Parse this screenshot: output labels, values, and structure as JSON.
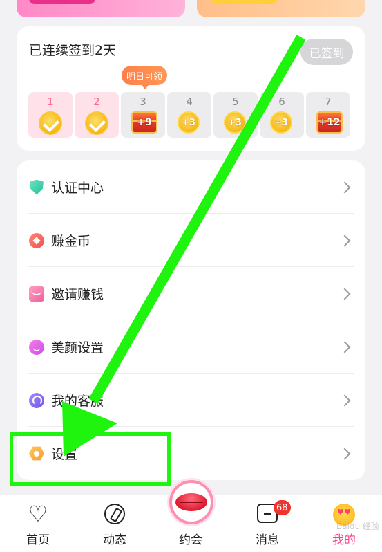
{
  "checkin": {
    "title": "已连续签到2天",
    "button_label": "已签到",
    "tomorrow_tip": "明日可领",
    "days": [
      {
        "num": "1",
        "state": "done",
        "reward": "check",
        "reward_text": ""
      },
      {
        "num": "2",
        "state": "done",
        "reward": "check",
        "reward_text": ""
      },
      {
        "num": "3",
        "state": "pending",
        "reward": "chest",
        "reward_text": "+9"
      },
      {
        "num": "4",
        "state": "pending",
        "reward": "coin",
        "reward_text": "+3"
      },
      {
        "num": "5",
        "state": "pending",
        "reward": "coin",
        "reward_text": "+3"
      },
      {
        "num": "6",
        "state": "pending",
        "reward": "coin",
        "reward_text": "+3"
      },
      {
        "num": "7",
        "state": "pending",
        "reward": "chest",
        "reward_text": "+12"
      }
    ]
  },
  "menu": {
    "items": [
      {
        "label": "认证中心",
        "icon": "shield-icon"
      },
      {
        "label": "赚金币",
        "icon": "coin-icon"
      },
      {
        "label": "邀请赚钱",
        "icon": "invite-icon"
      },
      {
        "label": "美颜设置",
        "icon": "beauty-icon"
      },
      {
        "label": "我的客服",
        "icon": "customer-service-icon"
      },
      {
        "label": "设置",
        "icon": "settings-icon"
      }
    ]
  },
  "nav": {
    "home": "首页",
    "feed": "动态",
    "dating": "约会",
    "messages": "消息",
    "messages_badge": "68",
    "mine": "我的"
  },
  "watermark": "Baidu 经验",
  "colors": {
    "accent_pink": "#ff3f8a",
    "highlight_green": "#1ff40f",
    "badge_red": "#f1332f"
  }
}
